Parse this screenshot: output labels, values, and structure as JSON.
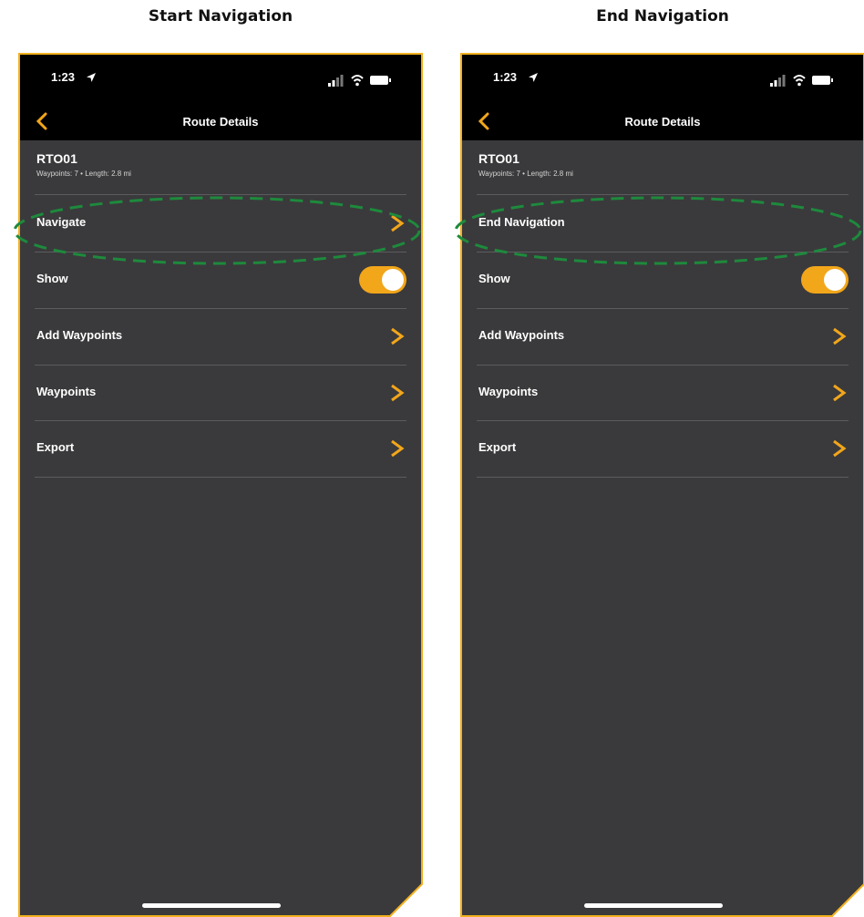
{
  "panels": [
    {
      "caption": "Start Navigation",
      "status": {
        "time": "1:23"
      },
      "nav": {
        "title": "Route Details"
      },
      "route": {
        "name": "RTO01",
        "meta": "Waypoints: 7  •  Length: 2.8 mi"
      },
      "rows": [
        {
          "label": "Navigate",
          "control": "chevron"
        },
        {
          "label": "Show",
          "control": "toggle",
          "toggle_on": true
        },
        {
          "label": "Add Waypoints",
          "control": "chevron"
        },
        {
          "label": "Waypoints",
          "control": "chevron"
        },
        {
          "label": "Export",
          "control": "chevron"
        }
      ]
    },
    {
      "caption": "End Navigation",
      "status": {
        "time": "1:23"
      },
      "nav": {
        "title": "Route Details"
      },
      "route": {
        "name": "RTO01",
        "meta": "Waypoints: 7  •  Length: 2.8 mi"
      },
      "rows": [
        {
          "label": "End Navigation",
          "control": "none"
        },
        {
          "label": "Show",
          "control": "toggle",
          "toggle_on": true
        },
        {
          "label": "Add Waypoints",
          "control": "chevron"
        },
        {
          "label": "Waypoints",
          "control": "chevron"
        },
        {
          "label": "Export",
          "control": "chevron"
        }
      ]
    }
  ],
  "colors": {
    "accent": "#f2a61a",
    "frame_outline": "#f2b01e",
    "highlight_ellipse": "#1e8a3c",
    "screen_background": "#3a3a3c",
    "bar_background": "#000000"
  },
  "icons": {
    "back": "chevron-left-icon",
    "row_chevron": "chevron-right-icon",
    "location": "location-arrow-icon",
    "signal": "cellular-signal-icon",
    "wifi": "wifi-icon",
    "battery": "battery-icon"
  }
}
